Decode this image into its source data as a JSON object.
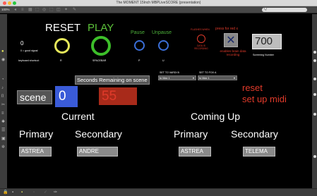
{
  "window": {
    "title": "The MOMENT 15Inch MBPLiveSCORE (presentation)"
  },
  "toolbar": {
    "zoom": "100%",
    "search_placeholder": "Q"
  },
  "controls": {
    "reset_label": "RESET",
    "play_label": "PLAY",
    "pause_label": "Pause",
    "unpause_label": "Unpause",
    "signal_value": "0",
    "signal_hint": "0 = good signal",
    "keyboard_shortcut_label": "keyboard shortcut:",
    "reset_key": "R",
    "play_key": "SPACEBAR",
    "pause_key": "P",
    "unpause_key": "U",
    "flashes_label": "FLASHES WHEN",
    "data_is_recording_label": "DATA IS RECORDING",
    "press_for_red_label": "press for red x",
    "enables_brain_label": "enables brain data recording",
    "screening_number_value": "700",
    "screening_number_label": "Screening Number"
  },
  "set_to": {
    "vardi_label": "SET TO VARDI B",
    "vardi_value": "to Max 1",
    "fox_label": "SET TO FOX A",
    "fox_value": "to Max 1"
  },
  "scene": {
    "label": "scene",
    "value": "0",
    "seconds_remaining_label": "Seconds Remaining on scene",
    "seconds_remaining_value": "55",
    "reset_midi_line1": "reset",
    "reset_midi_line2": "set up midi"
  },
  "current": {
    "heading": "Current",
    "primary_label": "Primary",
    "secondary_label": "Secondary",
    "primary_value": "ASTREA",
    "secondary_value": "ANDRE"
  },
  "coming_up": {
    "heading": "Coming Up",
    "primary_label": "Primary",
    "secondary_label": "Secondary",
    "primary_value": "ASTREA",
    "secondary_value": "TELEMA"
  },
  "colors": {
    "reset": "#ffffff",
    "play": "#5cc23a",
    "pause_text": "#4caf3a",
    "pause_ring": "#3b6fd8",
    "alert_red": "#e03a2a",
    "ring_yellow": "#e6e85a",
    "ring_green": "#3dbf2a",
    "scene_blue": "#3a5bd8",
    "seconds_red": "#a82a1a",
    "name_box": "#8a8a8a"
  },
  "icons": [
    "lock-icon",
    "comment-icon",
    "grid-icon",
    "zoom-icon",
    "wrench-icon",
    "search-icon"
  ]
}
